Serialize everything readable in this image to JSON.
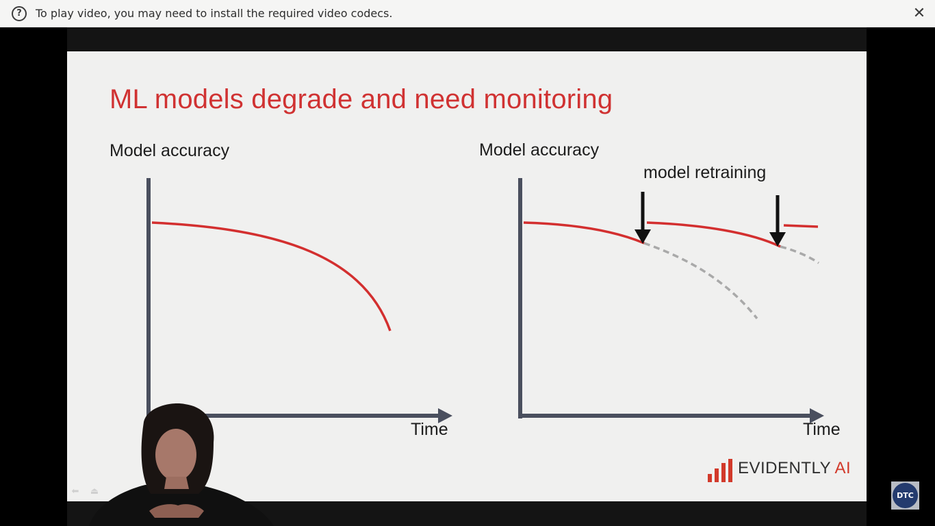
{
  "notice_bar": {
    "icon": "help-circle-icon",
    "message": "To play video, you may need to install the required video codecs.",
    "close_icon": "close-icon"
  },
  "slide": {
    "title": "ML models degrade and need monitoring",
    "left_plot": {
      "ylabel": "Model accuracy",
      "xlabel": "Time"
    },
    "right_plot": {
      "ylabel": "Model accuracy",
      "xlabel": "Time",
      "annotation": "model retraining"
    },
    "logo": {
      "word": "EVIDENTLY",
      "suffix": "AI",
      "color": "#d23a2b"
    }
  },
  "colors": {
    "title": "#d03232",
    "curve": "#d32f2f",
    "axis": "#4a4f5e",
    "dashed": "#a9a9a9",
    "slide_bg": "#f0f0ef"
  },
  "badge": {
    "label": "DTC"
  },
  "controls": {
    "icons": [
      "back-arrow-icon",
      "eject-icon"
    ]
  }
}
